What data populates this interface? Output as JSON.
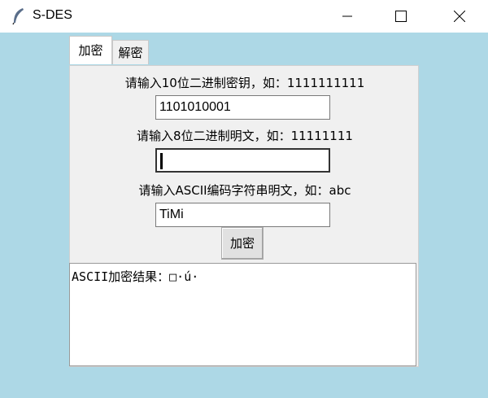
{
  "window": {
    "title": "S-DES",
    "icon": "feather-icon",
    "controls": [
      "minimize",
      "maximize",
      "close"
    ]
  },
  "tabs": [
    {
      "label": "加密",
      "active": true
    },
    {
      "label": "解密",
      "active": false
    }
  ],
  "form": {
    "key_label": "请输入10位二进制密钥，如：1111111111",
    "key_value": "1101010001",
    "plaintext_label": "请输入8位二进制明文，如：11111111",
    "plaintext_value": "",
    "ascii_label": "请输入ASCII编码字符串明文，如：abc",
    "ascii_value": "TiMi",
    "encrypt_button": "加密"
  },
  "output": {
    "text": "ASCII加密结果：□·ú·"
  },
  "colors": {
    "background": "#add8e6",
    "panel": "#f0f0f0"
  }
}
